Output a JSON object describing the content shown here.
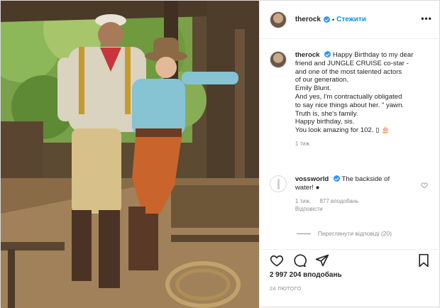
{
  "post": {
    "photo_alt": "",
    "header": {
      "username": "therock",
      "separator": "•",
      "follow_label": "Стежити",
      "more_label": "•••"
    },
    "caption": {
      "username": "therock",
      "lines": [
        "Happy Birthday to my dear",
        "friend and JUNGLE CRUISE co-star -",
        "and one of the most talented actors",
        "of our generation.",
        "Emily Blunt.",
        "And yes, I'm contractually obligated",
        "to say nice things about her. \" yawn.",
        "Truth is, she's family.",
        "Happy birthday, sis.",
        "You look amazing for 102. ▯ 🎂"
      ],
      "time": "1 тиж."
    },
    "comment": {
      "username": "vossworld",
      "text_line1": "The backside of",
      "text_line2": "water! ●",
      "time": "1 тиж.",
      "likes": "877 вподобань",
      "reply_label": "Відповісти",
      "view_replies": "Переглянути відповіді (20)"
    },
    "actions": {
      "like_count": "2 997 204 вподобань",
      "date": "24 ЛЮТОГО"
    },
    "colors": {
      "link": "#0095f6",
      "verified": "#3897f0",
      "muted": "#8e8e8e"
    }
  }
}
